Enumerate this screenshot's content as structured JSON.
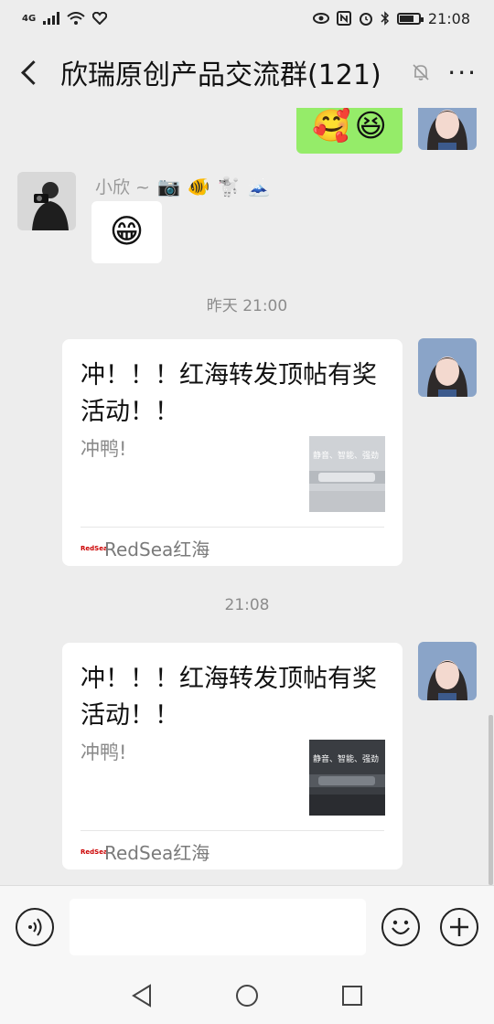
{
  "status_bar": {
    "network": "4G",
    "time": "21:08"
  },
  "nav": {
    "title": "欣瑞原创产品交流群(121)"
  },
  "messages": [
    {
      "type": "image-emoji",
      "side": "right",
      "emojis": [
        "🥰",
        "😆"
      ]
    },
    {
      "type": "emoji",
      "side": "left",
      "sender": "小欣 ~",
      "sender_emojis": [
        "📷",
        "🐠",
        "🐩",
        "🗻"
      ],
      "emoji": "😁"
    },
    {
      "type": "time",
      "text": "昨天 21:00"
    },
    {
      "type": "card",
      "side": "right",
      "title": "冲！！！红海转发顶帖有奖活动！！",
      "desc": "冲鸭!",
      "source": "RedSea红海",
      "thumb_text": "静音、智能、强劲",
      "thumb_style": "light"
    },
    {
      "type": "time",
      "text": "21:08"
    },
    {
      "type": "card",
      "side": "right",
      "title": "冲！！！红海转发顶帖有奖活动！！",
      "desc": "冲鸭!",
      "source": "RedSea红海",
      "thumb_text": "静音、智能、强劲",
      "thumb_style": "dark"
    }
  ],
  "time_1": "昨天 21:00",
  "time_2": "21:08",
  "sender_name": "小欣 ~",
  "card_1": {
    "title": "冲！！！红海转发顶帖有奖活动！！",
    "desc": "冲鸭!",
    "source": "RedSea红海",
    "thumb_text": "静音、智能、强劲",
    "logo_text": "RedSea"
  },
  "card_2": {
    "title": "冲！！！红海转发顶帖有奖活动！！",
    "desc": "冲鸭!",
    "source": "RedSea红海",
    "thumb_text": "静音、智能、强劲",
    "logo_text": "RedSea"
  },
  "icons": {
    "voice": "voice-icon",
    "emoji": "emoji-icon",
    "plus": "plus-icon",
    "back": "back-icon",
    "mute": "mute-icon",
    "more": "more-icon"
  },
  "colors": {
    "background": "#ededed",
    "self_bubble": "#95ec69",
    "other_bubble": "#ffffff"
  }
}
